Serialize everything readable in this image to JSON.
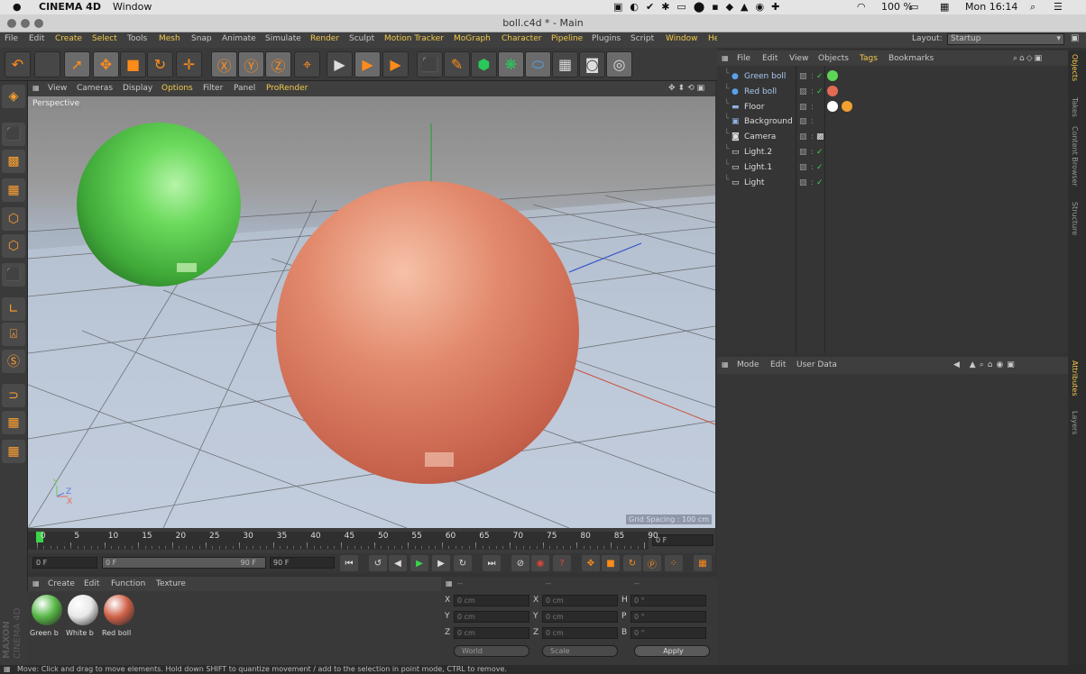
{
  "macbar": {
    "app_name": "CINEMA 4D",
    "menu_window": "Window",
    "battery": "100 %",
    "clock": "Mon 16:14"
  },
  "window": {
    "title": "boll.c4d * - Main"
  },
  "menu": {
    "items": [
      "File",
      "Edit",
      "Create",
      "Select",
      "Tools",
      "Mesh",
      "Snap",
      "Animate",
      "Simulate",
      "Render",
      "Sculpt",
      "Motion Tracker",
      "MoGraph",
      "Character",
      "Pipeline",
      "Plugins",
      "Script",
      "Window",
      "Help"
    ]
  },
  "layout": {
    "label": "Layout:",
    "value": "Startup"
  },
  "viewport": {
    "menu": [
      "View",
      "Cameras",
      "Display",
      "Options",
      "Filter",
      "Panel",
      "ProRender"
    ],
    "label": "Perspective",
    "grid_spacing": "Grid Spacing : 100 cm"
  },
  "timeline": {
    "ticks": [
      "0",
      "5",
      "10",
      "15",
      "20",
      "25",
      "30",
      "35",
      "40",
      "45",
      "50",
      "55",
      "60",
      "65",
      "70",
      "75",
      "80",
      "85",
      "90"
    ],
    "current_frame": "0 F"
  },
  "playbar": {
    "start": "0 F",
    "range_start": "0 F",
    "range_end": "90 F",
    "end": "90 F"
  },
  "materials": {
    "menu": [
      "Create",
      "Edit",
      "Function",
      "Texture"
    ],
    "items": [
      {
        "name": "Green b",
        "color": "#58b848"
      },
      {
        "name": "White b",
        "color": "#e8e8e8"
      },
      {
        "name": "Red boll",
        "color": "#d0624a"
      }
    ]
  },
  "coordinates": {
    "header": [
      "--",
      "--",
      "--"
    ],
    "rows": [
      {
        "a": "X",
        "av": "0 cm",
        "b": "X",
        "bv": "0 cm",
        "c": "H",
        "cv": "0 °"
      },
      {
        "a": "Y",
        "av": "0 cm",
        "b": "Y",
        "bv": "0 cm",
        "c": "P",
        "cv": "0 °"
      },
      {
        "a": "Z",
        "av": "0 cm",
        "b": "Z",
        "bv": "0 cm",
        "c": "B",
        "cv": "0 °"
      }
    ],
    "mode": "World",
    "size_mode": "Scale",
    "apply": "Apply"
  },
  "objects": {
    "menu": [
      "File",
      "Edit",
      "View",
      "Objects",
      "Tags",
      "Bookmarks"
    ],
    "items": [
      {
        "name": "Green boll",
        "icon": "sphere-icon"
      },
      {
        "name": "Red boll",
        "icon": "sphere-icon"
      },
      {
        "name": "Floor",
        "icon": "floor-icon"
      },
      {
        "name": "Background",
        "icon": "background-icon"
      },
      {
        "name": "Camera",
        "icon": "camera-icon"
      },
      {
        "name": "Light.2",
        "icon": "light-icon"
      },
      {
        "name": "Light.1",
        "icon": "light-icon"
      },
      {
        "name": "Light",
        "icon": "light-icon"
      }
    ]
  },
  "attributes": {
    "menu": [
      "Mode",
      "Edit",
      "User Data"
    ]
  },
  "side_tabs": [
    "Objects",
    "Takes",
    "Content Browser",
    "Structure",
    "Attributes",
    "Layers"
  ],
  "brand": {
    "maxon": "MAXON",
    "c4d": "CINEMA 4D"
  },
  "status": {
    "text": "Move: Click and drag to move elements. Hold down SHIFT to quantize movement / add to the selection in point mode, CTRL to remove."
  },
  "colors": {
    "accent": "#ff8c1a",
    "highlight": "#f2c94c",
    "green_ball": "#5ed458",
    "red_ball": "#e2896c"
  }
}
